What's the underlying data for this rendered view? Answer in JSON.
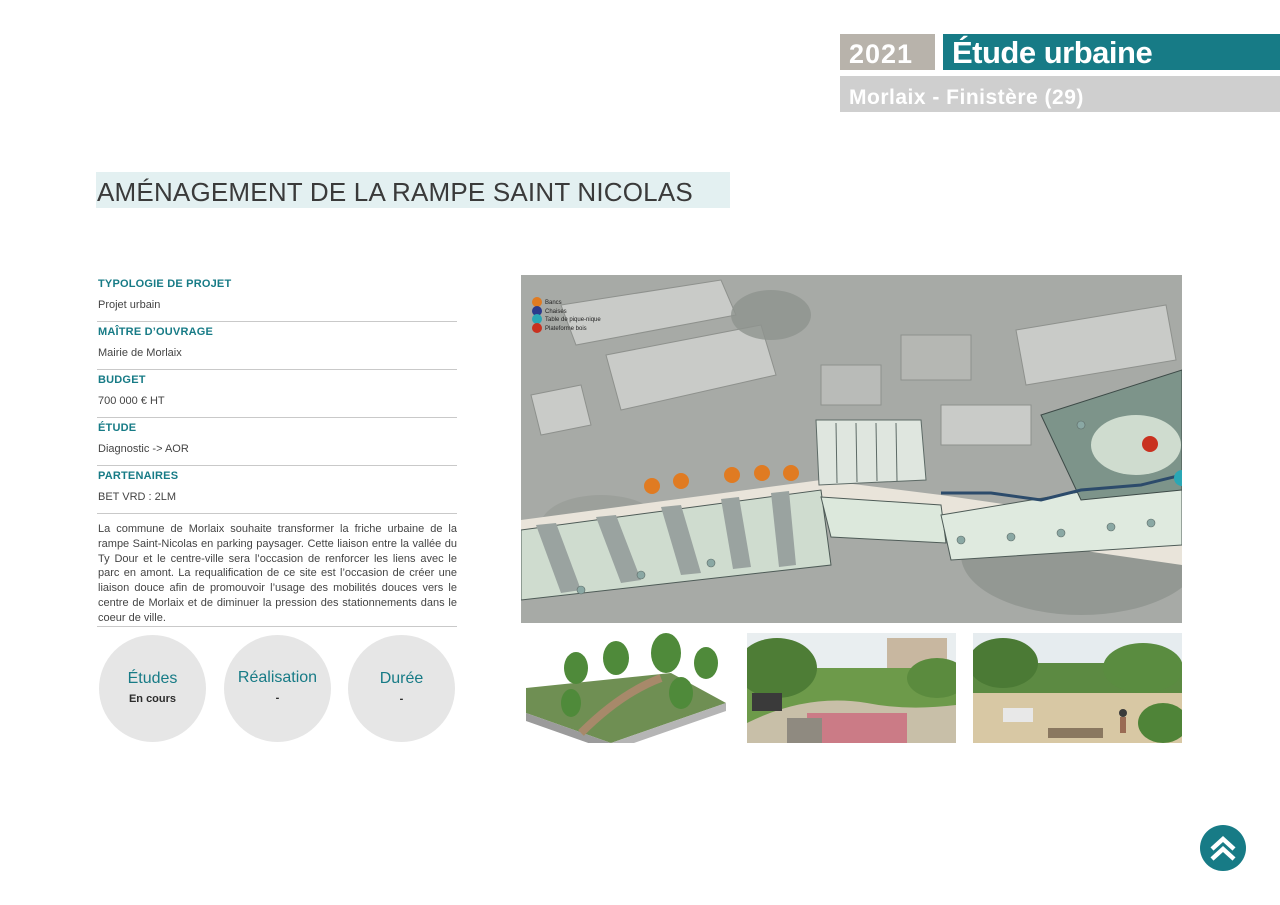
{
  "header": {
    "year": "2021",
    "title": "Étude urbaine",
    "location": "Morlaix - Finistère (29)"
  },
  "page_title": "AMÉNAGEMENT DE LA RAMPE SAINT NICOLAS",
  "info": [
    {
      "label": "TYPOLOGIE DE PROJET",
      "value": "Projet urbain"
    },
    {
      "label": "MAÎTRE D’OUVRAGE",
      "value": "Mairie de Morlaix"
    },
    {
      "label": "BUDGET",
      "value": "700 000 € HT"
    },
    {
      "label": "ÉTUDE",
      "value": "Diagnostic -> AOR"
    },
    {
      "label": "PARTENAIRES",
      "value": "BET VRD : 2LM"
    }
  ],
  "description": "La commune de Morlaix souhaite transformer la friche urbaine de la rampe Saint-Nicolas en parking paysager. Cette liaison entre la vallée du Ty Dour et le centre-ville sera l’occasion de renforcer les liens avec le parc en amont. La requalification de ce site est l’occasion de créer une liaison douce afin de promouvoir l’usage des mobilités douces vers le centre de Morlaix et de diminuer la pression des stationnements dans le coeur de ville.",
  "status": [
    {
      "title": "Études",
      "value": "En cours"
    },
    {
      "title": "Réalisation",
      "value": "-"
    },
    {
      "title": "Durée",
      "value": "-"
    }
  ],
  "plan_legend": [
    {
      "label": "Bancs",
      "color": "#e07b22"
    },
    {
      "label": "Chaises",
      "color": "#2b3a8c"
    },
    {
      "label": "Table de pique-nique",
      "color": "#2aa7b5"
    },
    {
      "label": "Plateforme bois",
      "color": "#c9311f"
    }
  ],
  "colors": {
    "accent": "#177b86",
    "year_bg": "#b8b3ab",
    "location_bg": "#cfcfcf",
    "title_bg": "#e3f0f1"
  }
}
